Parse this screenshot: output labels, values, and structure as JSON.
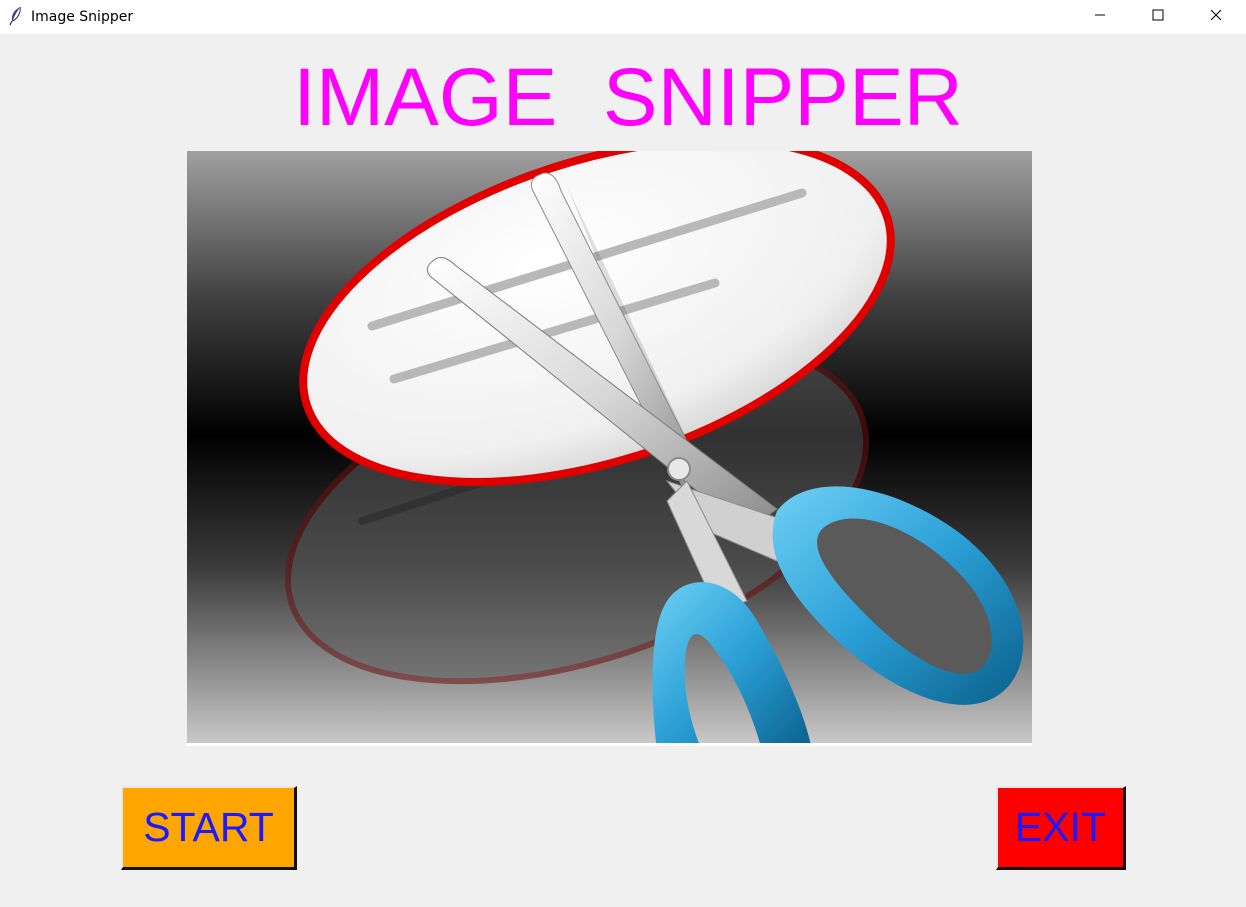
{
  "window": {
    "title": "Image Snipper",
    "icon": "feather-icon",
    "controls": [
      "minimize-icon",
      "maximize-icon",
      "close-icon"
    ]
  },
  "heading": {
    "text": "IMAGE  SNIPPER",
    "color": "#ff00ff"
  },
  "image": {
    "description_icon": "scissors-icon"
  },
  "buttons": {
    "start": {
      "label": "START",
      "bg": "#ffa500",
      "fg": "#1a1aff"
    },
    "exit": {
      "label": "EXIT",
      "bg": "#ff0000",
      "fg": "#1a1aff"
    }
  },
  "colors": {
    "background": "#f0f0f0",
    "titlebar": "#ffffff"
  }
}
